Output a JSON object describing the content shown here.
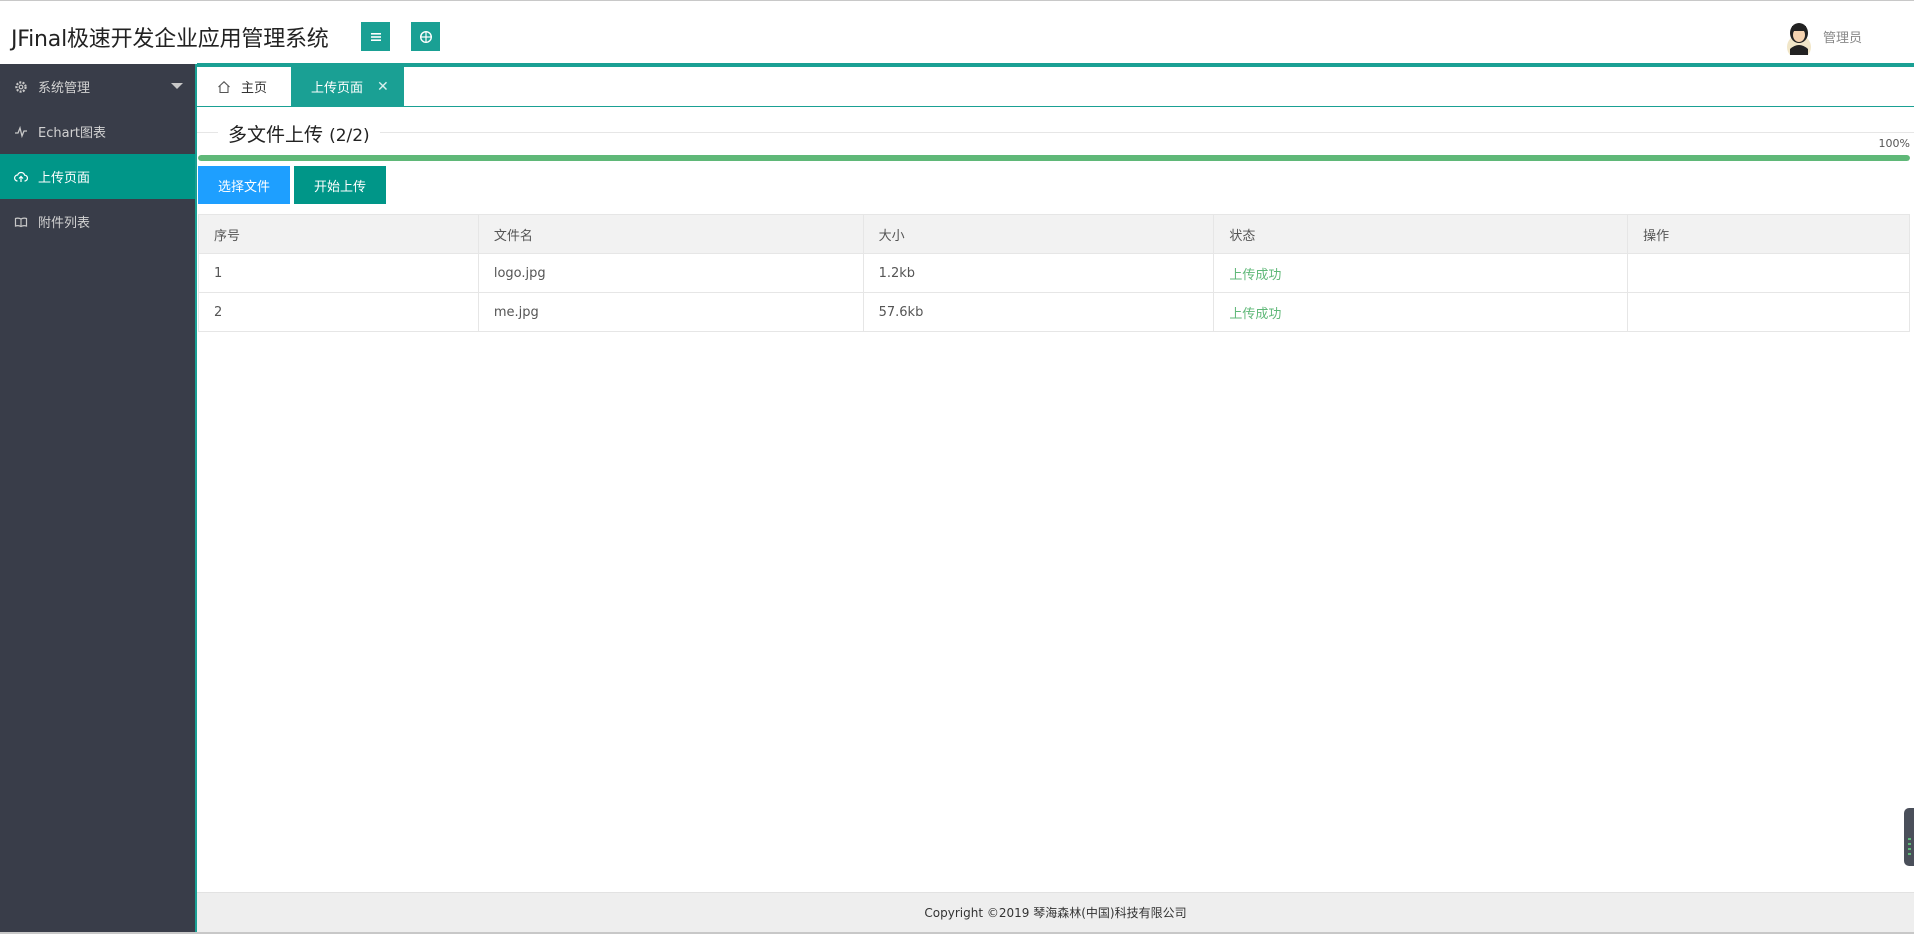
{
  "header": {
    "app_title": "JFinal极速开发企业应用管理系统",
    "user_name": "管理员"
  },
  "sidebar": {
    "items": [
      {
        "label": "系统管理",
        "icon": "gear-icon"
      },
      {
        "label": "Echart图表",
        "icon": "pulse-icon"
      },
      {
        "label": "上传页面",
        "icon": "cloud-upload-icon"
      },
      {
        "label": "附件列表",
        "icon": "book-icon"
      }
    ],
    "active_index": 2
  },
  "tabs": [
    {
      "label": "主页",
      "icon": "home-icon"
    },
    {
      "label": "上传页面",
      "close": "✕"
    }
  ],
  "upload": {
    "title": "多文件上传",
    "count": "(2/2)",
    "progress_label": "100%",
    "progress": 1.0,
    "select_label": "选择文件",
    "start_label": "开始上传"
  },
  "table": {
    "headers": [
      "序号",
      "文件名",
      "大小",
      "状态",
      "操作"
    ],
    "rows": [
      {
        "index": "1",
        "name": "logo.jpg",
        "size": "1.2kb",
        "status": "上传成功",
        "action": ""
      },
      {
        "index": "2",
        "name": "me.jpg",
        "size": "57.6kb",
        "status": "上传成功",
        "action": ""
      }
    ]
  },
  "footer": {
    "copyright": "Copyright ©2019 琴海森林(中国)科技有限公司"
  },
  "colors": {
    "accent": "#1aa094",
    "sidebar_bg": "#393d49",
    "active": "#009688",
    "blue": "#1e9fff",
    "success": "#5fb878"
  }
}
